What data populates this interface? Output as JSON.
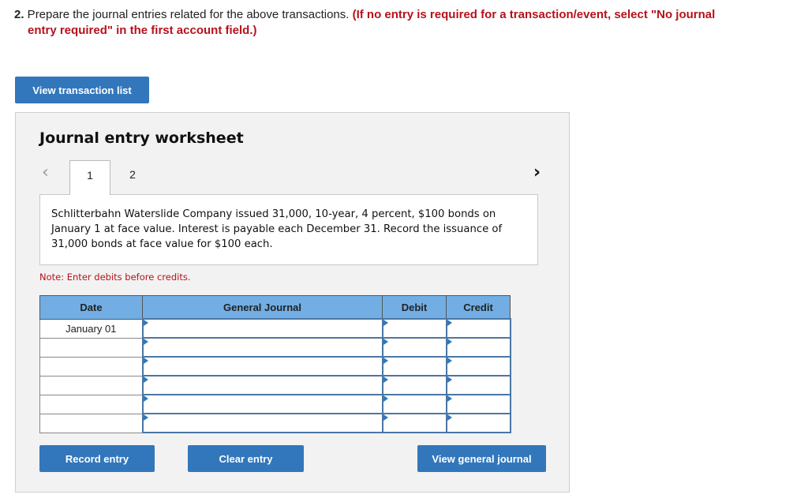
{
  "question": {
    "number": "2.",
    "text": " Prepare the journal entries related for the above transactions. ",
    "instruction_line1": "(If no entry is required for a transaction/event, select \"No journal",
    "instruction_line2": "entry required\" in the first account field.)"
  },
  "buttons": {
    "view_transaction_list": "View transaction list",
    "record_entry": "Record entry",
    "clear_entry": "Clear entry",
    "view_general_journal": "View general journal"
  },
  "worksheet": {
    "title": "Journal entry worksheet",
    "nav_prev_icon": "chevron-left",
    "nav_next_icon": "chevron-right",
    "tabs": [
      {
        "label": "1",
        "active": true
      },
      {
        "label": "2",
        "active": false
      }
    ],
    "description": "Schlitterbahn Waterslide Company issued 31,000, 10-year, 4 percent, $100 bonds on January 1 at face value. Interest is payable each December 31. Record the issuance of 31,000 bonds at face value for $100 each.",
    "note": "Note: Enter debits before credits."
  },
  "table": {
    "headers": [
      "Date",
      "General Journal",
      "Debit",
      "Credit"
    ],
    "rows": [
      {
        "date": "January 01",
        "account": "",
        "debit": "",
        "credit": ""
      },
      {
        "date": "",
        "account": "",
        "debit": "",
        "credit": ""
      },
      {
        "date": "",
        "account": "",
        "debit": "",
        "credit": ""
      },
      {
        "date": "",
        "account": "",
        "debit": "",
        "credit": ""
      },
      {
        "date": "",
        "account": "",
        "debit": "",
        "credit": ""
      },
      {
        "date": "",
        "account": "",
        "debit": "",
        "credit": ""
      }
    ]
  },
  "colors": {
    "button_blue": "#3277bb",
    "header_blue": "#72aee4",
    "instruction_red": "#b5121b"
  }
}
